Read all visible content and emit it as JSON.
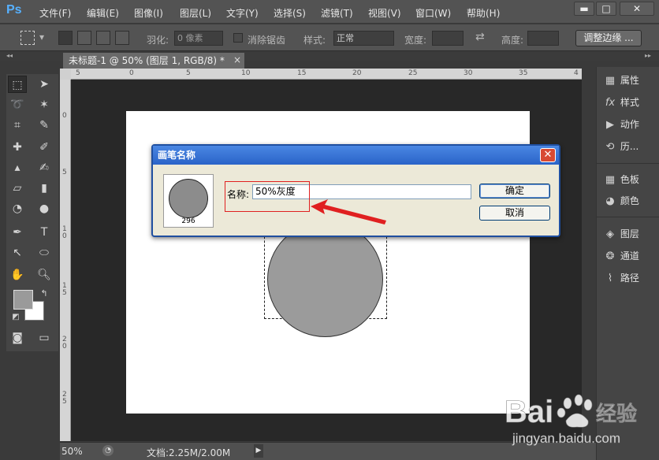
{
  "app": {
    "logo": "Ps"
  },
  "menu": {
    "items": [
      "文件(F)",
      "编辑(E)",
      "图像(I)",
      "图层(L)",
      "文字(Y)",
      "选择(S)",
      "滤镜(T)",
      "视图(V)",
      "窗口(W)",
      "帮助(H)"
    ]
  },
  "window_controls": {
    "minimize": "▬",
    "maximize": "□",
    "close": "✕"
  },
  "options": {
    "feather_label": "羽化:",
    "feather_value": "0 像素",
    "antialias_label": "消除锯齿",
    "style_label": "样式:",
    "style_value": "正常",
    "width_label": "宽度:",
    "height_label": "高度:",
    "refine_edge": "调整边缘 ..."
  },
  "document": {
    "tab_title": "未标题-1 @ 50% (图层 1, RGB/8) *",
    "tab_close": "×"
  },
  "rulers": {
    "top_ticks": [
      "5",
      "0",
      "5",
      "10",
      "15",
      "20",
      "25",
      "30",
      "35",
      "4"
    ],
    "left_ticks": [
      "0",
      "5",
      "1\n0",
      "1\n5",
      "2\n0",
      "2\n5"
    ]
  },
  "right_panel": {
    "group1": [
      {
        "icon": "properties-icon",
        "glyph": "▦",
        "label": "属性"
      },
      {
        "icon": "styles-icon",
        "glyph": "fx",
        "label": "样式"
      },
      {
        "icon": "actions-icon",
        "glyph": "▶",
        "label": "动作"
      },
      {
        "icon": "history-icon",
        "glyph": "⟲",
        "label": "历..."
      }
    ],
    "group2": [
      {
        "icon": "swatches-icon",
        "glyph": "▦",
        "label": "色板"
      },
      {
        "icon": "color-icon",
        "glyph": "◕",
        "label": "颜色"
      }
    ],
    "group3": [
      {
        "icon": "layers-icon",
        "glyph": "◈",
        "label": "图层"
      },
      {
        "icon": "channels-icon",
        "glyph": "❂",
        "label": "通道"
      },
      {
        "icon": "paths-icon",
        "glyph": "⌇",
        "label": "路径"
      }
    ]
  },
  "status": {
    "zoom": "50%",
    "doc_info": "文档:2.25M/2.00M",
    "arrow": "▶"
  },
  "dialog": {
    "title": "画笔名称",
    "brush_size": "296",
    "name_label": "名称:",
    "name_value": "50%灰度",
    "ok": "确定",
    "cancel": "取消",
    "close": "✕"
  },
  "watermark": {
    "brand": "Bai",
    "brand_suffix": "经验",
    "url": "jingyan.baidu.com"
  },
  "colors": {
    "annotation_red": "#e02020",
    "dialog_border": "#1f4fa0"
  }
}
